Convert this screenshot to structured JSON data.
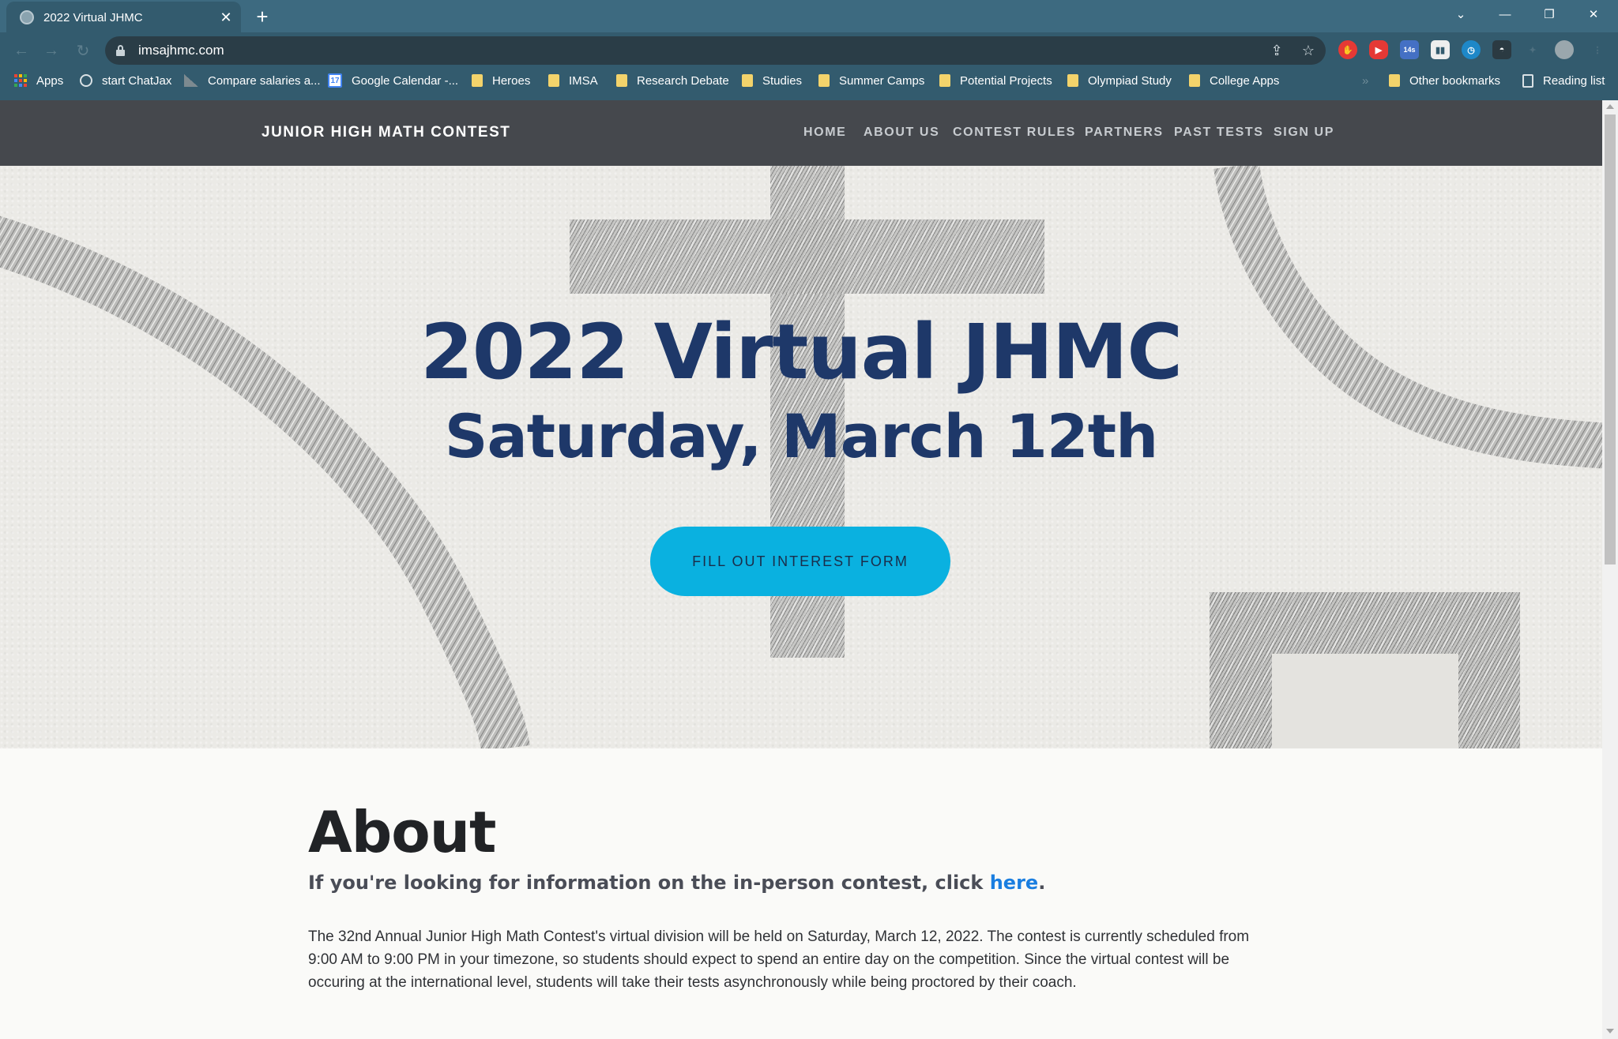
{
  "browser": {
    "tab_title": "2022 Virtual JHMC",
    "url": "imsajhmc.com",
    "badge_count": "14s",
    "bookmarks": [
      {
        "label": "Apps",
        "icon": "apps-grid-icon"
      },
      {
        "label": "start ChatJax",
        "icon": "globe-icon"
      },
      {
        "label": "Compare salaries a...",
        "icon": "chart-icon"
      },
      {
        "label": "Google Calendar -...",
        "icon": "calendar-icon"
      },
      {
        "label": "Heroes",
        "icon": "folder-icon"
      },
      {
        "label": "IMSA",
        "icon": "folder-icon"
      },
      {
        "label": "Research Debate",
        "icon": "folder-icon"
      },
      {
        "label": "Studies",
        "icon": "folder-icon"
      },
      {
        "label": "Summer Camps",
        "icon": "folder-icon"
      },
      {
        "label": "Potential Projects",
        "icon": "folder-icon"
      },
      {
        "label": "Olympiad Study",
        "icon": "folder-icon"
      },
      {
        "label": "College Apps",
        "icon": "folder-icon"
      },
      {
        "label": "Other bookmarks",
        "icon": "folder-icon"
      },
      {
        "label": "Reading list",
        "icon": "reading-list-icon"
      }
    ],
    "calendar_day": "17"
  },
  "site": {
    "brand": "JUNIOR HIGH MATH CONTEST",
    "nav": [
      "HOME",
      "ABOUT US",
      "CONTEST RULES",
      "PARTNERS",
      "PAST TESTS",
      "SIGN UP"
    ]
  },
  "hero": {
    "title": "2022 Virtual JHMC",
    "subtitle": "Saturday, March 12th",
    "cta_label": "FILL OUT INTEREST FORM"
  },
  "about": {
    "heading": "About",
    "lead_text": "If you're looking for information on the in-person contest, click ",
    "lead_link": "here",
    "lead_end": ".",
    "body": "The 32nd Annual Junior High Math Contest's virtual division will be held on Saturday, March 12, 2022. The contest is currently scheduled from 9:00 AM to 9:00 PM in your timezone, so students should expect to spend an entire day on the competition. Since the virtual contest will be occuring at the international level, students will take their tests asynchronously while being proctored by their coach."
  },
  "colors": {
    "nav_bg": "#45484d",
    "title_navy": "#1e3869",
    "cta_cyan": "#0ab1e0",
    "link_blue": "#1a7ee0",
    "chrome_teal": "#3d6a80"
  }
}
